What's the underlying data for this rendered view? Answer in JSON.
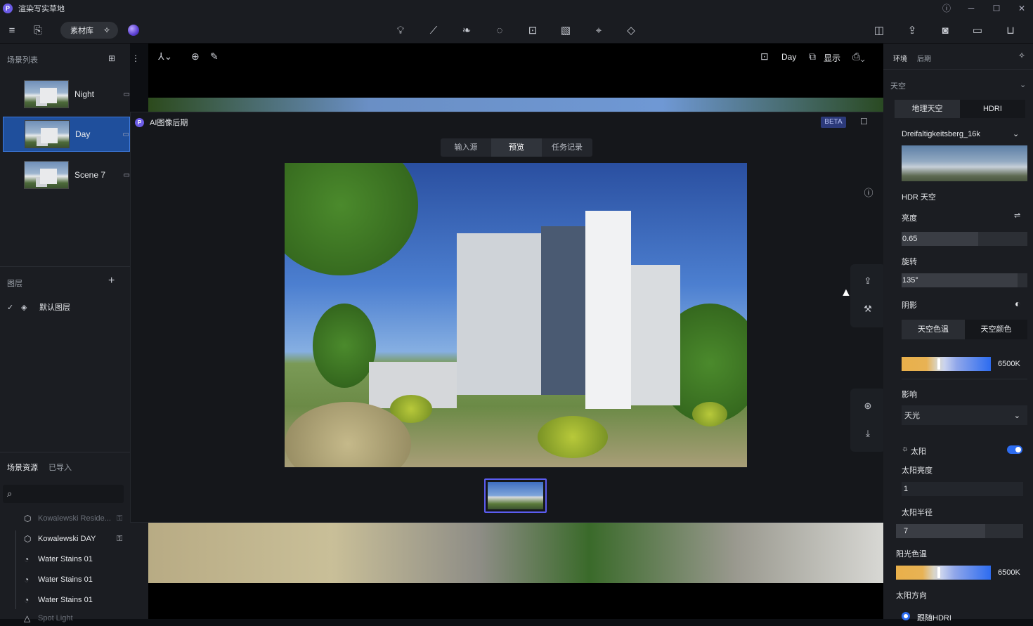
{
  "app": {
    "title": "渲染写实草地",
    "logo_letter": "P"
  },
  "toolbar": {
    "library_label": "素材库",
    "center_icons": [
      "lightbulb-icon",
      "path-icon",
      "leaf-icon",
      "fire-icon",
      "camera-rig-icon",
      "material-icon",
      "cursor-icon",
      "terrain-icon"
    ],
    "right_icons": [
      "vr-icon",
      "export-icon",
      "camera-icon",
      "video-icon",
      "inbox-icon"
    ]
  },
  "scene_list": {
    "header": "场景列表",
    "scenes": [
      {
        "name": "Night",
        "active": false
      },
      {
        "name": "Day",
        "active": true
      },
      {
        "name": "Scene 7",
        "active": false
      }
    ]
  },
  "layers": {
    "header": "图层",
    "items": [
      {
        "name": "默认图层",
        "checked": true
      }
    ]
  },
  "resources": {
    "tabs": [
      "场景资源",
      "已导入"
    ],
    "items": [
      {
        "name": "Kowalewski Reside...",
        "dim": true,
        "locked": true
      },
      {
        "name": "Kowalewski DAY",
        "dim": false,
        "locked": true
      },
      {
        "name": "Water Stains 01",
        "dim": false,
        "locked": false
      },
      {
        "name": "Water Stains 01",
        "dim": false,
        "locked": false
      },
      {
        "name": "Water Stains 01",
        "dim": false,
        "locked": false
      },
      {
        "name": "Spot Light",
        "dim": true,
        "locked": false
      }
    ]
  },
  "viewport": {
    "scene_label": "Day",
    "display_label": "显示"
  },
  "modal": {
    "title": "AI图像后期",
    "badge": "BETA",
    "tabs": [
      {
        "label": "输入源",
        "active": false
      },
      {
        "label": "预览",
        "active": true
      },
      {
        "label": "任务记录",
        "active": false
      }
    ]
  },
  "right_panel": {
    "tabs": [
      "环境",
      "后期"
    ],
    "sky_section": "天空",
    "sky_modes": [
      "地理天空",
      "HDRI"
    ],
    "hdri_name": "Dreifaltigkeitsberg_16k",
    "hdri_section": "HDR 天空",
    "brightness_label": "亮度",
    "brightness_value": "0.65",
    "rotation_label": "旋转",
    "rotation_value": "135°",
    "shadow_label": "阴影",
    "color_modes": [
      "天空色温",
      "天空颜色"
    ],
    "sky_temp": "6500K",
    "influence_label": "影响",
    "influence_value": "天光",
    "sun_label": "太阳",
    "sun_on": true,
    "sun_brightness_label": "太阳亮度",
    "sun_brightness_value": "1",
    "sun_radius_label": "太阳半径",
    "sun_radius_value": "7",
    "sun_temp_label": "阳光色温",
    "sun_temp": "6500K",
    "sun_dir_label": "太阳方向",
    "follow_hdri_label": "跟随HDRI"
  }
}
